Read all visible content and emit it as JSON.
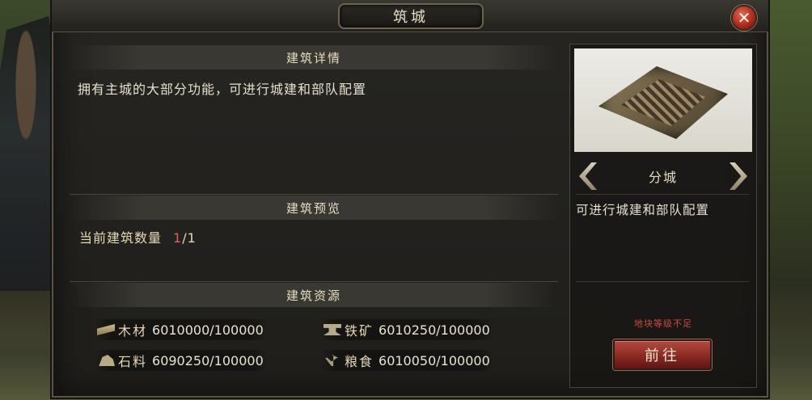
{
  "dialog": {
    "title": "筑城",
    "close_label": "✕"
  },
  "details": {
    "header": "建筑详情",
    "description": "拥有主城的大部分功能，可进行城建和部队配置"
  },
  "preview_section": {
    "header": "建筑预览",
    "count_label": "当前建筑数量",
    "count_current": "1",
    "count_total": "/1"
  },
  "resources": {
    "header": "建筑资源",
    "items": [
      {
        "icon": "wood-icon",
        "label": "木材",
        "value": "6010000/100000"
      },
      {
        "icon": "iron-icon",
        "label": "铁矿",
        "value": "6010250/100000"
      },
      {
        "icon": "stone-icon",
        "label": "石料",
        "value": "6090250/100000"
      },
      {
        "icon": "grain-icon",
        "label": "粮食",
        "value": "6010050/100000"
      }
    ]
  },
  "building": {
    "name": "分城",
    "description": "可进行城建和部队配置",
    "warning": "地块等级不足",
    "go_label": "前往"
  },
  "colors": {
    "accent_red": "#b12a1c",
    "current_count": "#e06050",
    "warning": "#d24b3a",
    "text_light": "#e8dcc2"
  }
}
